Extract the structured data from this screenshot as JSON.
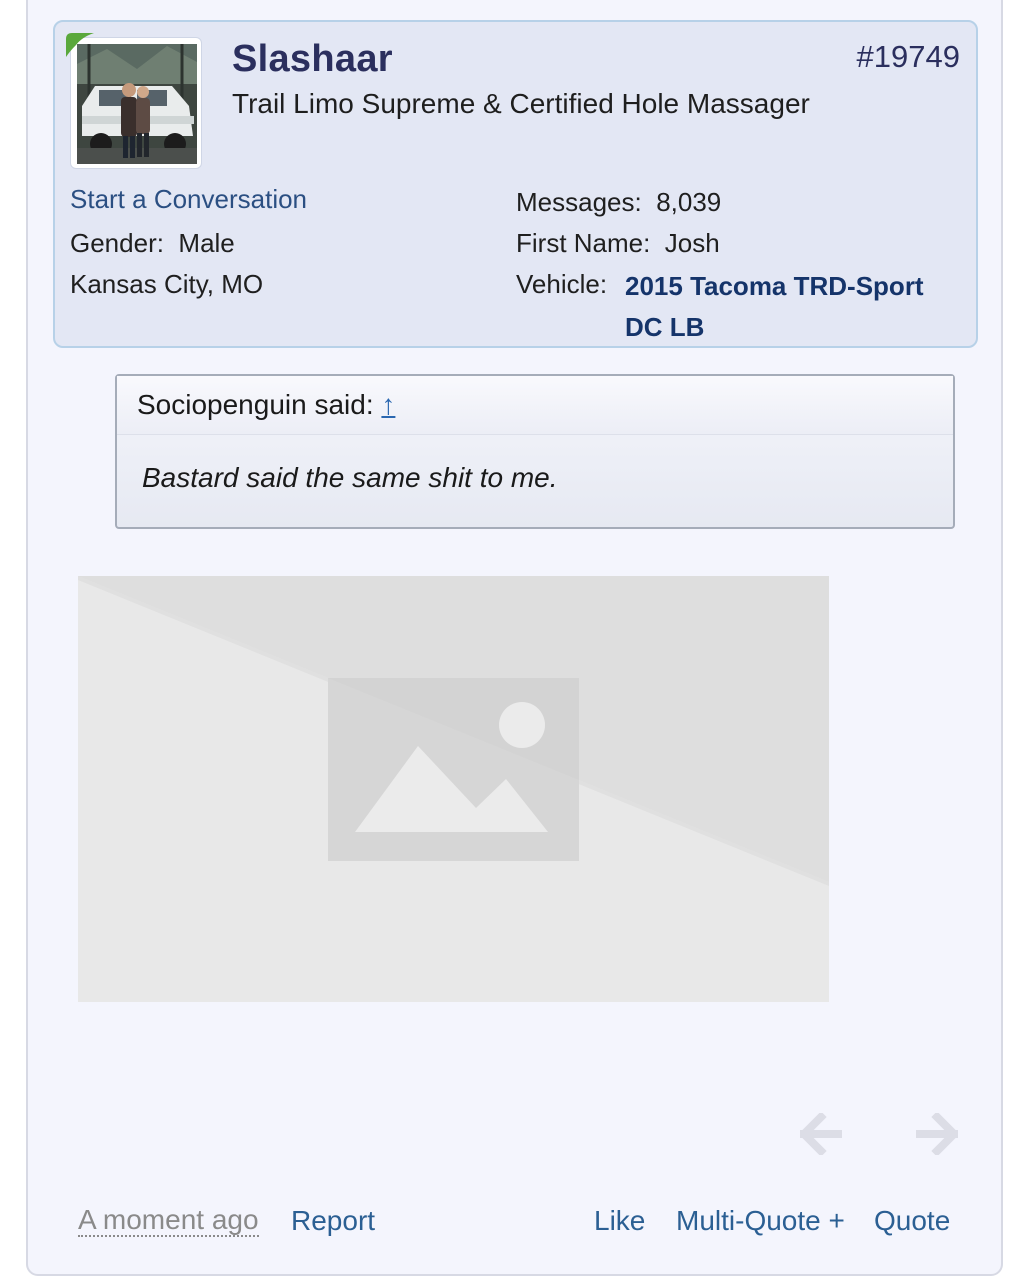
{
  "post": {
    "author": {
      "username": "Slashaar",
      "title": "Trail Limo Supreme & Certified Hole Massager",
      "avatar_icon": "user-avatar-photo",
      "online_indicator_color": "#5aa83c"
    },
    "post_number": "#19749",
    "user_info": {
      "start_conversation": "Start a Conversation",
      "gender_label": "Gender:",
      "gender_value": "Male",
      "location": "Kansas City, MO",
      "messages_label": "Messages:",
      "messages_value": "8,039",
      "first_name_label": "First Name:",
      "first_name_value": "Josh",
      "vehicle_label": "Vehicle:",
      "vehicle_value": "2015 Tacoma TRD-Sport DC LB"
    },
    "quote": {
      "author_said": "Sociopenguin said:",
      "jump_link": "↑",
      "body": "Bastard said the same shit to me."
    },
    "image": {
      "icon": "image-placeholder-icon"
    },
    "navigation": {
      "prev_icon": "arrow-left-icon",
      "next_icon": "arrow-right-icon"
    },
    "footer": {
      "date": "A moment ago",
      "report": "Report",
      "like": "Like",
      "multi_quote": "Multi-Quote +",
      "quote": "Quote"
    }
  },
  "colors": {
    "card_bg": "#e3e7f4",
    "card_border": "#b7d1e8",
    "page_bg": "#f4f5fd",
    "link": "#2b5f93",
    "vehicle_link": "#15346a",
    "username": "#2b2f5e"
  }
}
